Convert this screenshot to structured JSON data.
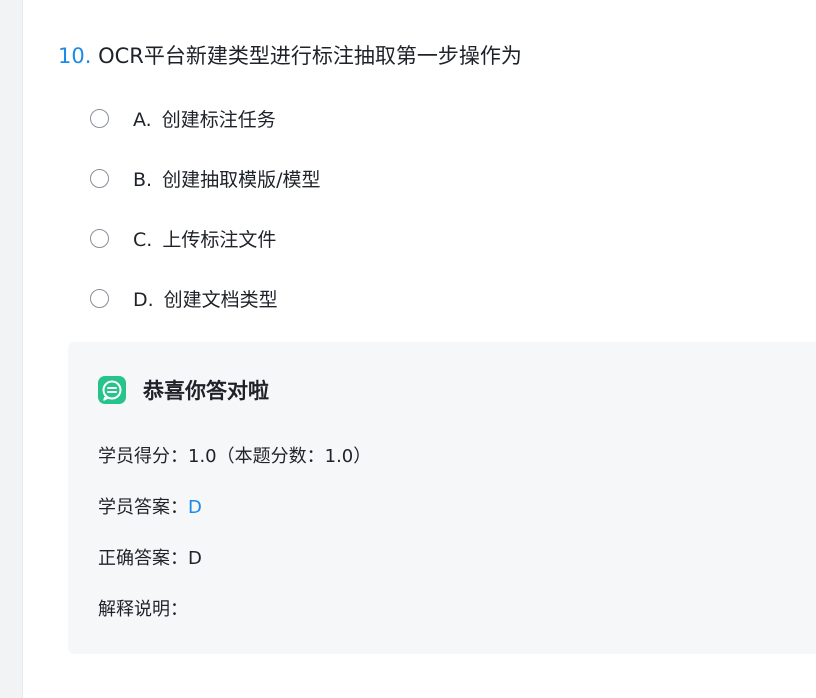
{
  "question": {
    "number": "10.",
    "text": "OCR平台新建类型进行标注抽取第一步操作为",
    "options": [
      {
        "letter": "A.",
        "text": "创建标注任务"
      },
      {
        "letter": "B.",
        "text": "创建抽取模版/模型"
      },
      {
        "letter": "C.",
        "text": "上传标注文件"
      },
      {
        "letter": "D.",
        "text": "创建文档类型"
      }
    ]
  },
  "feedback": {
    "icon": "chat-bubble-icon",
    "title": "恭喜你答对啦",
    "score_label": "学员得分：",
    "score_value": "1.0（本题分数：1.0）",
    "student_answer_label": "学员答案：",
    "student_answer_value": "D",
    "correct_answer_label": "正确答案：",
    "correct_answer_value": "D",
    "explanation_label": "解释说明：",
    "explanation_value": ""
  },
  "colors": {
    "accent": "#1c8ae6",
    "icon_green": "#27c38c",
    "feedback_bg": "#f6f7f9"
  }
}
